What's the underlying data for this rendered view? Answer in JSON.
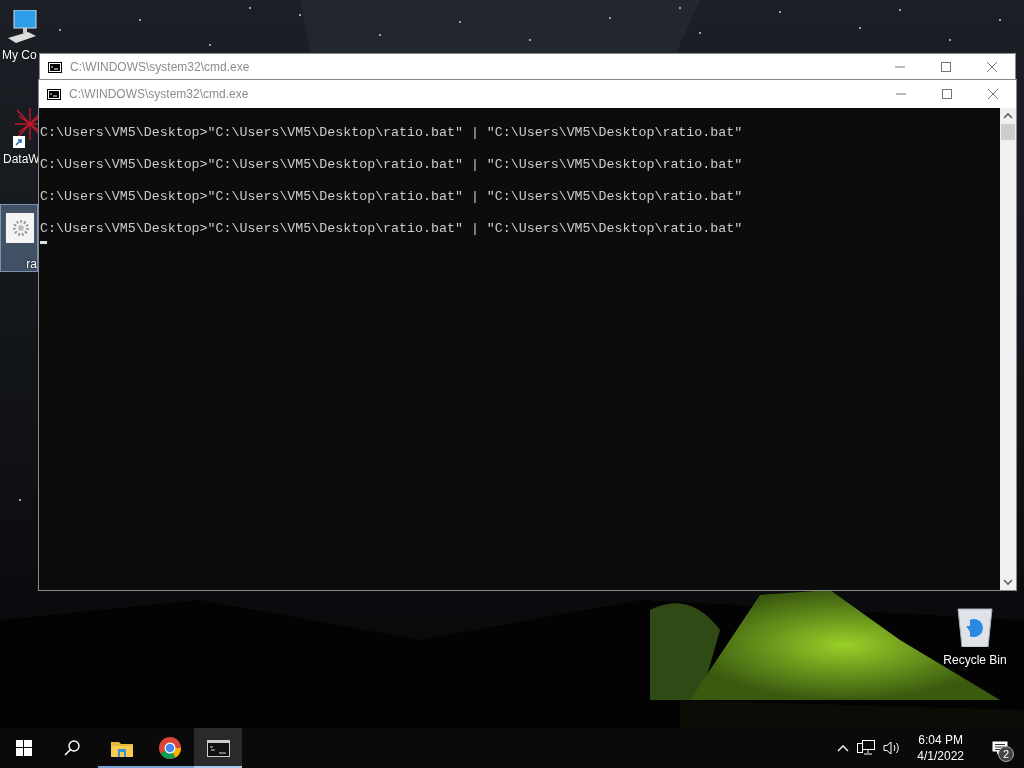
{
  "desktop": {
    "icons": [
      {
        "kind": "computer",
        "label": "My Co",
        "selected": false
      },
      {
        "kind": "shortcut",
        "label": "DataW",
        "selected": false
      },
      {
        "kind": "settings-file",
        "label": "ra",
        "selected": true
      },
      {
        "kind": "recycle-bin",
        "label": "Recycle Bin",
        "selected": false
      }
    ]
  },
  "windows": [
    {
      "title": "C:\\WINDOWS\\system32\\cmd.exe"
    },
    {
      "title": "C:\\WINDOWS\\system32\\cmd.exe",
      "console_lines": [
        "C:\\Users\\VM5\\Desktop>\"C:\\Users\\VM5\\Desktop\\ratio.bat\" | \"C:\\Users\\VM5\\Desktop\\ratio.bat\"",
        "C:\\Users\\VM5\\Desktop>\"C:\\Users\\VM5\\Desktop\\ratio.bat\" | \"C:\\Users\\VM5\\Desktop\\ratio.bat\"",
        "C:\\Users\\VM5\\Desktop>\"C:\\Users\\VM5\\Desktop\\ratio.bat\" | \"C:\\Users\\VM5\\Desktop\\ratio.bat\"",
        "C:\\Users\\VM5\\Desktop>\"C:\\Users\\VM5\\Desktop\\ratio.bat\" | \"C:\\Users\\VM5\\Desktop\\ratio.bat\""
      ]
    }
  ],
  "taskbar": {
    "apps": [
      {
        "kind": "start",
        "running": false,
        "active": false
      },
      {
        "kind": "search",
        "running": false,
        "active": false
      },
      {
        "kind": "explorer",
        "running": true,
        "active": false
      },
      {
        "kind": "chrome",
        "running": true,
        "active": false
      },
      {
        "kind": "terminal",
        "running": true,
        "active": true
      }
    ],
    "tray": {
      "time": "6:04 PM",
      "date": "4/1/2022",
      "notification_count": "2"
    }
  }
}
